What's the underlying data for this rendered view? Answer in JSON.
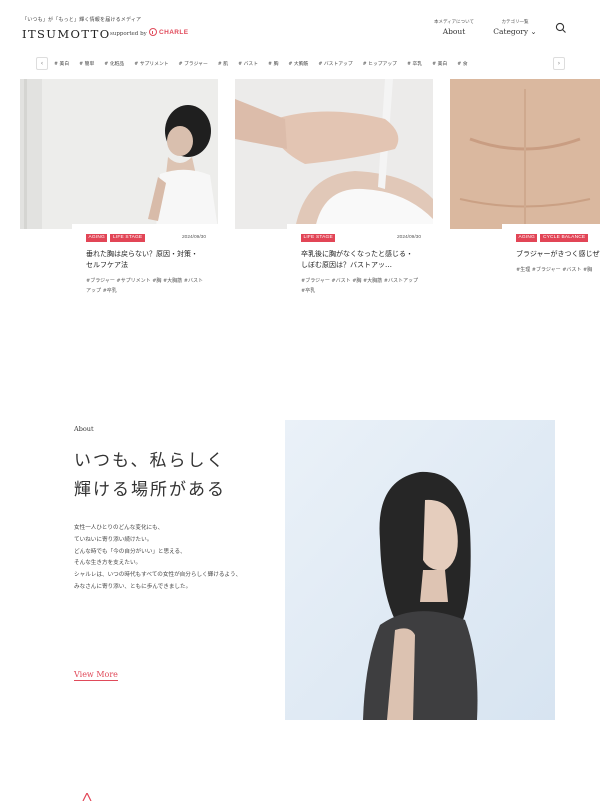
{
  "header": {
    "tagline": "「いつも」が「もっと」輝く情報を届けるメディア",
    "logo": "ITSUMOTTO",
    "supported_by": "supported by",
    "brand": "CHARLE",
    "nav": [
      {
        "sub": "本メディアについて",
        "label": "About"
      },
      {
        "sub": "カテゴリ一覧",
        "label": "Category ⌄"
      }
    ]
  },
  "tags": [
    "# 美白",
    "# 簡単",
    "# 化粧品",
    "# サプリメント",
    "# ブラジャー",
    "# 肌",
    "# バスト",
    "# 胸",
    "# 大胸筋",
    "# バストアップ",
    "# ヒップアップ",
    "# 卒乳",
    "# 美白",
    "# 食"
  ],
  "cards": [
    {
      "labels": [
        "AGING",
        "LIFE STAGE"
      ],
      "date": "2024/09/30",
      "title": "垂れた胸は戻らない？原因・対策・セルフケア法",
      "tags": "#ブラジャー #サプリメント #胸 #大胸筋 #バストアップ #卒乳"
    },
    {
      "labels": [
        "LIFE STAGE"
      ],
      "date": "2024/09/30",
      "title": "卒乳後に胸がなくなったと感じる・しぼむ原因は？バストアッ…",
      "tags": "#ブラジャー #バスト #胸 #大胸筋 #バストアップ #卒乳"
    },
    {
      "labels": [
        "AGING",
        "CYCLE BALANCE"
      ],
      "date": "",
      "title": "ブラジャーがきつく感じぜ？きつさの原因から改",
      "tags": "#生理 #ブラジャー #バスト #胸"
    }
  ],
  "about": {
    "small": "About",
    "heading": [
      "いつも、私らしく",
      "輝ける場所がある"
    ],
    "body": [
      "女性一人ひとりのどんな変化にも、",
      "ていねいに寄り添い続けたい。",
      "どんな時でも「今の自分がいい」と思える、",
      "そんな生き方を支えたい。",
      "シャルレは、いつの時代もすべての女性が自分らしく輝けるよう、",
      "みなさんに寄り添い、ともに歩んできました。"
    ],
    "view_more": "View More"
  },
  "colors": {
    "accent": "#e24556",
    "text": "#222222"
  }
}
